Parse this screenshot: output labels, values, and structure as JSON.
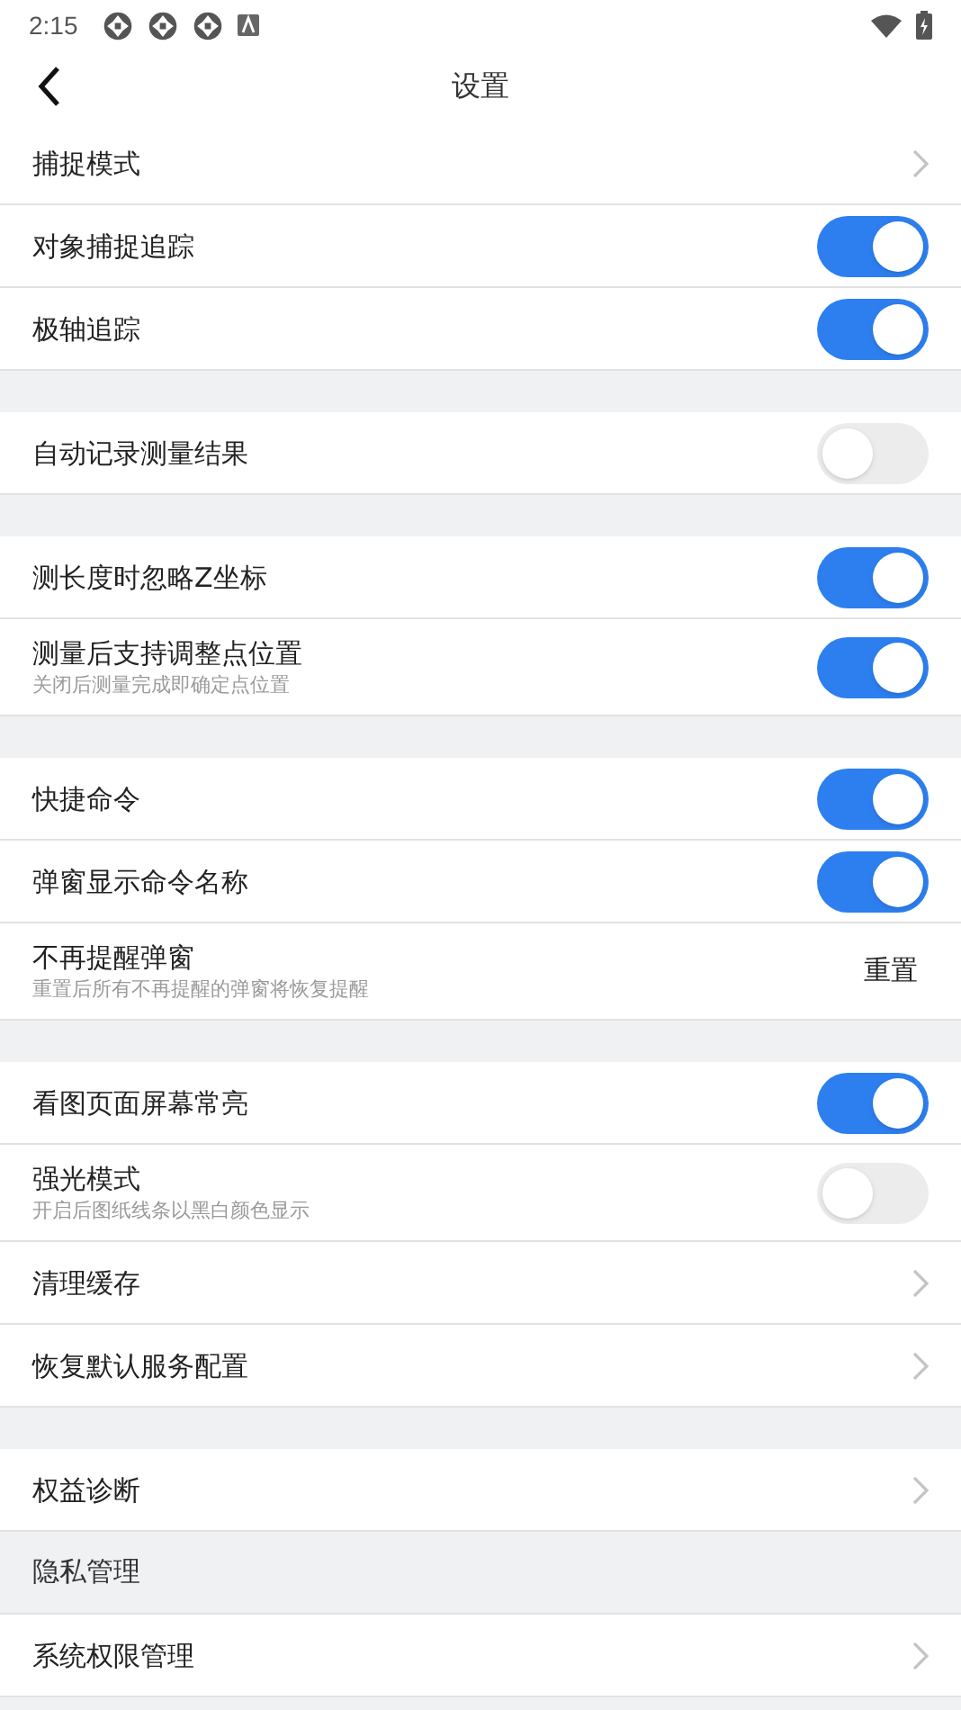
{
  "status_bar": {
    "time": "2:15"
  },
  "header": {
    "title": "设置"
  },
  "groups": [
    {
      "items": [
        {
          "kind": "link",
          "label": "捕捉模式"
        },
        {
          "kind": "toggle",
          "label": "对象捕捉追踪",
          "on": true
        },
        {
          "kind": "toggle",
          "label": "极轴追踪",
          "on": true
        }
      ]
    },
    {
      "items": [
        {
          "kind": "toggle",
          "label": "自动记录测量结果",
          "on": false
        }
      ]
    },
    {
      "items": [
        {
          "kind": "toggle",
          "label": "测长度时忽略Z坐标",
          "on": true
        },
        {
          "kind": "toggle",
          "label": "测量后支持调整点位置",
          "subtitle": "关闭后测量完成即确定点位置",
          "on": true
        }
      ]
    },
    {
      "items": [
        {
          "kind": "toggle",
          "label": "快捷命令",
          "on": true
        },
        {
          "kind": "toggle",
          "label": "弹窗显示命令名称",
          "on": true
        },
        {
          "kind": "action",
          "label": "不再提醒弹窗",
          "subtitle": "重置后所有不再提醒的弹窗将恢复提醒",
          "action": "重置"
        }
      ]
    },
    {
      "items": [
        {
          "kind": "toggle",
          "label": "看图页面屏幕常亮",
          "on": true
        },
        {
          "kind": "toggle",
          "label": "强光模式",
          "subtitle": "开启后图纸线条以黑白颜色显示",
          "on": false
        },
        {
          "kind": "link",
          "label": "清理缓存"
        },
        {
          "kind": "link",
          "label": "恢复默认服务配置"
        }
      ]
    },
    {
      "items": [
        {
          "kind": "link",
          "label": "权益诊断"
        },
        {
          "kind": "header",
          "label": "隐私管理"
        },
        {
          "kind": "link",
          "label": "系统权限管理"
        }
      ]
    }
  ]
}
